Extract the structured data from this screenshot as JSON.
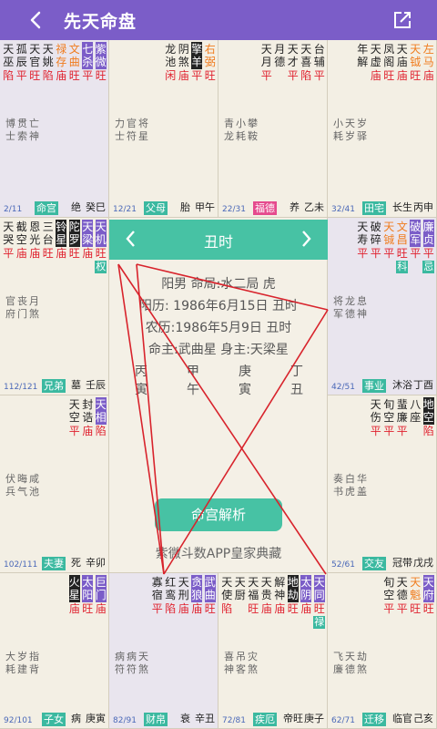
{
  "header": {
    "title": "先天命盘",
    "back_icon": "back-chevron-icon",
    "share_icon": "share-icon"
  },
  "colors": {
    "header": "#7b5dc8",
    "accent": "#47c2a4",
    "red": "#e0212e",
    "orange": "#f07c1e",
    "green": "#3bb9a0",
    "pink": "#e54a8d",
    "lines": "#d8232c"
  },
  "center": {
    "tab_label": "丑时",
    "line1": "阳男 命局:水二局 虎",
    "line2": "阳历: 1986年6月15日 丑时",
    "line3": "农历:1986年5月9日 丑时",
    "line4": "命主:武曲星 身主:天梁星",
    "bazi_top": [
      "丙",
      "甲",
      "庚",
      "丁"
    ],
    "bazi_bottom": [
      "寅",
      "午",
      "寅",
      "丑"
    ],
    "analyze_label": "命宫解析",
    "footer": "紫微斗数APP皇家典藏"
  },
  "cells": [
    {
      "stars": [
        {
          "n": "天巫",
          "c": "#222",
          "b": "陷"
        },
        {
          "n": "孤辰",
          "c": "#222",
          "b": "平"
        },
        {
          "n": "天官",
          "c": "#222",
          "b": "旺"
        },
        {
          "n": "天姚",
          "c": "#222",
          "b": "陷"
        },
        {
          "n": "禄存",
          "c": "#f07c1e",
          "b": "庙"
        },
        {
          "n": "文曲",
          "c": "#f07c1e",
          "b": "旺"
        },
        {
          "n": "七杀",
          "c": "#fff",
          "bg": "#7b5dc8",
          "b": "平"
        },
        {
          "n": "紫微",
          "c": "#fff",
          "bg": "#7b5dc8",
          "b": "旺"
        }
      ],
      "minor": [
        "博士",
        "贯索",
        "亡神"
      ],
      "age": "2/11",
      "palace": "命宫",
      "stage": "绝",
      "gz": "癸巳"
    },
    {
      "stars": [
        {
          "n": "龙池",
          "c": "#222",
          "b": "闲"
        },
        {
          "n": "阴煞",
          "c": "#222",
          "b": "庙"
        },
        {
          "n": "擎羊",
          "c": "#fff",
          "bg": "#222",
          "b": "平"
        },
        {
          "n": "右弼",
          "c": "#f07c1e",
          "b": "旺"
        }
      ],
      "minor": [
        "力士",
        "官符",
        "将星"
      ],
      "age": "12/21",
      "palace": "父母",
      "stage": "胎",
      "gz": "甲午"
    },
    {
      "stars": [
        {
          "n": "天月",
          "c": "#222",
          "b": "平"
        },
        {
          "n": "月德",
          "c": "#222",
          "b": ""
        },
        {
          "n": "天才",
          "c": "#222",
          "b": "平"
        },
        {
          "n": "天喜",
          "c": "#222",
          "b": "陷"
        },
        {
          "n": "台辅",
          "c": "#222",
          "b": "平"
        }
      ],
      "minor": [
        "青龙",
        "小耗",
        "攀鞍"
      ],
      "age": "22/31",
      "palace": "福德",
      "palace_color": "pink",
      "stage": "养",
      "gz": "乙未"
    },
    {
      "stars": [
        {
          "n": "年解",
          "c": "#222",
          "b": ""
        },
        {
          "n": "天虚",
          "c": "#222",
          "b": "庙"
        },
        {
          "n": "凤阁",
          "c": "#222",
          "b": "旺"
        },
        {
          "n": "天庙",
          "c": "#222",
          "b": "庙"
        },
        {
          "n": "天钺",
          "c": "#f07c1e",
          "b": "旺"
        },
        {
          "n": "左马",
          "c": "#f07c1e",
          "b": "庙"
        }
      ],
      "minor": [
        "小耗",
        "天岁",
        "岁驿"
      ],
      "age": "32/41",
      "palace": "田宅",
      "stage": "长生",
      "gz": "丙申"
    },
    {
      "stars": [
        {
          "n": "天哭",
          "c": "#222",
          "b": "平"
        },
        {
          "n": "截空",
          "c": "#222",
          "b": "庙"
        },
        {
          "n": "恩光",
          "c": "#222",
          "b": "庙"
        },
        {
          "n": "三台",
          "c": "#222",
          "b": "旺"
        },
        {
          "n": "铃星",
          "c": "#fff",
          "bg": "#222",
          "b": "庙"
        },
        {
          "n": "陀罗",
          "c": "#fff",
          "bg": "#222",
          "b": "旺"
        },
        {
          "n": "天梁",
          "c": "#fff",
          "bg": "#7b5dc8",
          "b": "庙"
        },
        {
          "n": "天机",
          "c": "#fff",
          "bg": "#7b5dc8",
          "b": "旺",
          "h": "权"
        }
      ],
      "minor": [
        "官府",
        "丧门",
        "月煞"
      ],
      "age": "112/121",
      "palace": "兄弟",
      "stage": "墓",
      "gz": "壬辰"
    },
    {
      "stars": [
        {
          "n": "天寿",
          "c": "#222",
          "b": "平"
        },
        {
          "n": "破碎",
          "c": "#222",
          "b": "平"
        },
        {
          "n": "天铖",
          "c": "#f07c1e",
          "b": "平"
        },
        {
          "n": "文昌",
          "c": "#f07c1e",
          "b": "旺",
          "h": "科"
        },
        {
          "n": "破军",
          "c": "#fff",
          "bg": "#7b5dc8",
          "b": "平"
        },
        {
          "n": "廉贞",
          "c": "#fff",
          "bg": "#7b5dc8",
          "b": "平",
          "h": "忌"
        }
      ],
      "minor": [
        "将军",
        "龙德",
        "息神"
      ],
      "age": "42/51",
      "palace": "事业",
      "stage": "沐浴",
      "gz": "丁酉"
    },
    {
      "stars": [
        {
          "n": "天空",
          "c": "#222",
          "b": "平"
        },
        {
          "n": "封诰",
          "c": "#222",
          "b": "庙"
        },
        {
          "n": "天相",
          "c": "#fff",
          "bg": "#7b5dc8",
          "b": "陷"
        }
      ],
      "minor": [
        "伏兵",
        "晦气",
        "咸池"
      ],
      "age": "102/111",
      "palace": "夫妻",
      "stage": "死",
      "gz": "辛卯"
    },
    {
      "stars": [
        {
          "n": "天伤",
          "c": "#222",
          "b": "平"
        },
        {
          "n": "旬空",
          "c": "#222",
          "b": "平"
        },
        {
          "n": "蜚廉",
          "c": "#222",
          "b": "平"
        },
        {
          "n": "八座",
          "c": "#222",
          "b": ""
        },
        {
          "n": "地空",
          "c": "#fff",
          "bg": "#222",
          "b": "陷"
        }
      ],
      "minor": [
        "奏书",
        "白虎",
        "华盖"
      ],
      "age": "52/61",
      "palace": "交友",
      "stage": "冠带",
      "gz": "戊戌"
    },
    {
      "stars": [
        {
          "n": "火星",
          "c": "#fff",
          "bg": "#222",
          "b": "庙"
        },
        {
          "n": "太阳",
          "c": "#fff",
          "bg": "#7b5dc8",
          "b": "旺"
        },
        {
          "n": "巨门",
          "c": "#fff",
          "bg": "#7b5dc8",
          "b": "庙"
        }
      ],
      "minor": [
        "大耗",
        "岁建",
        "指背"
      ],
      "age": "92/101",
      "palace": "子女",
      "stage": "病",
      "gz": "庚寅"
    },
    {
      "stars": [
        {
          "n": "寡宿",
          "c": "#222",
          "b": "平"
        },
        {
          "n": "红鸾",
          "c": "#222",
          "b": "陷"
        },
        {
          "n": "天刑",
          "c": "#222",
          "b": "庙"
        },
        {
          "n": "贪狼",
          "c": "#fff",
          "bg": "#7b5dc8",
          "b": "庙"
        },
        {
          "n": "武曲",
          "c": "#fff",
          "bg": "#7b5dc8",
          "b": "旺"
        }
      ],
      "minor": [
        "病符",
        "病符",
        "天煞"
      ],
      "age": "82/91",
      "palace": "财帛",
      "stage": "衰",
      "gz": "辛丑"
    },
    {
      "stars": [
        {
          "n": "天使",
          "c": "#222",
          "b": "陷"
        },
        {
          "n": "天厨",
          "c": "#222",
          "b": ""
        },
        {
          "n": "天福",
          "c": "#222",
          "b": "旺"
        },
        {
          "n": "天贵",
          "c": "#222",
          "b": "庙"
        },
        {
          "n": "解神",
          "c": "#222",
          "b": "庙"
        },
        {
          "n": "地劫",
          "c": "#fff",
          "bg": "#222",
          "b": "旺"
        },
        {
          "n": "太阴",
          "c": "#fff",
          "bg": "#7b5dc8",
          "b": "庙"
        },
        {
          "n": "天同",
          "c": "#fff",
          "bg": "#7b5dc8",
          "b": "旺",
          "h": "禄"
        }
      ],
      "minor": [
        "喜神",
        "吊客",
        "灾煞"
      ],
      "age": "72/81",
      "palace": "疾厄",
      "stage": "帝旺",
      "gz": "庚子"
    },
    {
      "stars": [
        {
          "n": "旬空",
          "c": "#222",
          "b": "平"
        },
        {
          "n": "天德",
          "c": "#222",
          "b": "平"
        },
        {
          "n": "天魁",
          "c": "#f07c1e",
          "b": "旺"
        },
        {
          "n": "天府",
          "c": "#fff",
          "bg": "#7b5dc8",
          "b": "旺"
        }
      ],
      "minor": [
        "飞廉",
        "天德",
        "劫煞"
      ],
      "age": "62/71",
      "palace": "迁移",
      "stage": "临官",
      "gz": "己亥"
    }
  ]
}
